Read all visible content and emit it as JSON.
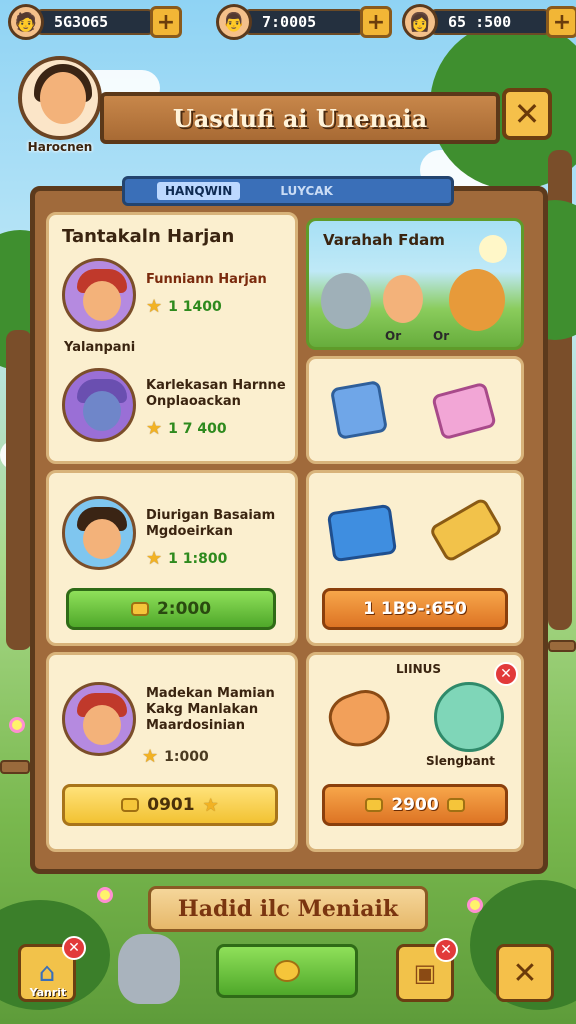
{
  "resources": [
    {
      "value": "5G3O65",
      "plus": "+"
    },
    {
      "value": "7:0005",
      "plus": "+"
    },
    {
      "value": "65 :500",
      "plus": "+"
    }
  ],
  "hero": {
    "name": "Harocnen"
  },
  "title": "Uasdufi ai Unenaia",
  "close_symbol": "✕",
  "tabs": [
    {
      "label": "HANQWIN"
    },
    {
      "label": "LUYCAK"
    }
  ],
  "quests": {
    "card1_title": "Tantakaln Harjan",
    "q1": {
      "name": "Funniann Harjan",
      "reward": "1 1400"
    },
    "q1_sublabel": "Yalanpani",
    "q2": {
      "name_line1": "Karlekasan Harnne",
      "name_line2": "Onplaoackan",
      "reward": "1 7 400"
    },
    "q3": {
      "name_line1": "Diurigan Basaiam",
      "name_line2": "Mgdoeirkan",
      "reward": "1 1:800",
      "button": "2:000"
    },
    "q4": {
      "name_line1": "Madekan Mamian",
      "name_line2": "Kakg Manlakan",
      "name_line3": "Maardosinian",
      "reward": "1:000",
      "button": "0901"
    }
  },
  "shop": {
    "scene_title": "Varahah Fdam",
    "scene_tag1": "Or",
    "scene_tag2": "Or",
    "price1": "1 1B9-:650",
    "bonus_title": "LIINUS",
    "bonus_item": "Slengbant",
    "price2": "2900"
  },
  "bottom": {
    "banner": "Hadid ilc Meniaik",
    "home_label": "Yanrit",
    "close_symbol": "✕"
  }
}
